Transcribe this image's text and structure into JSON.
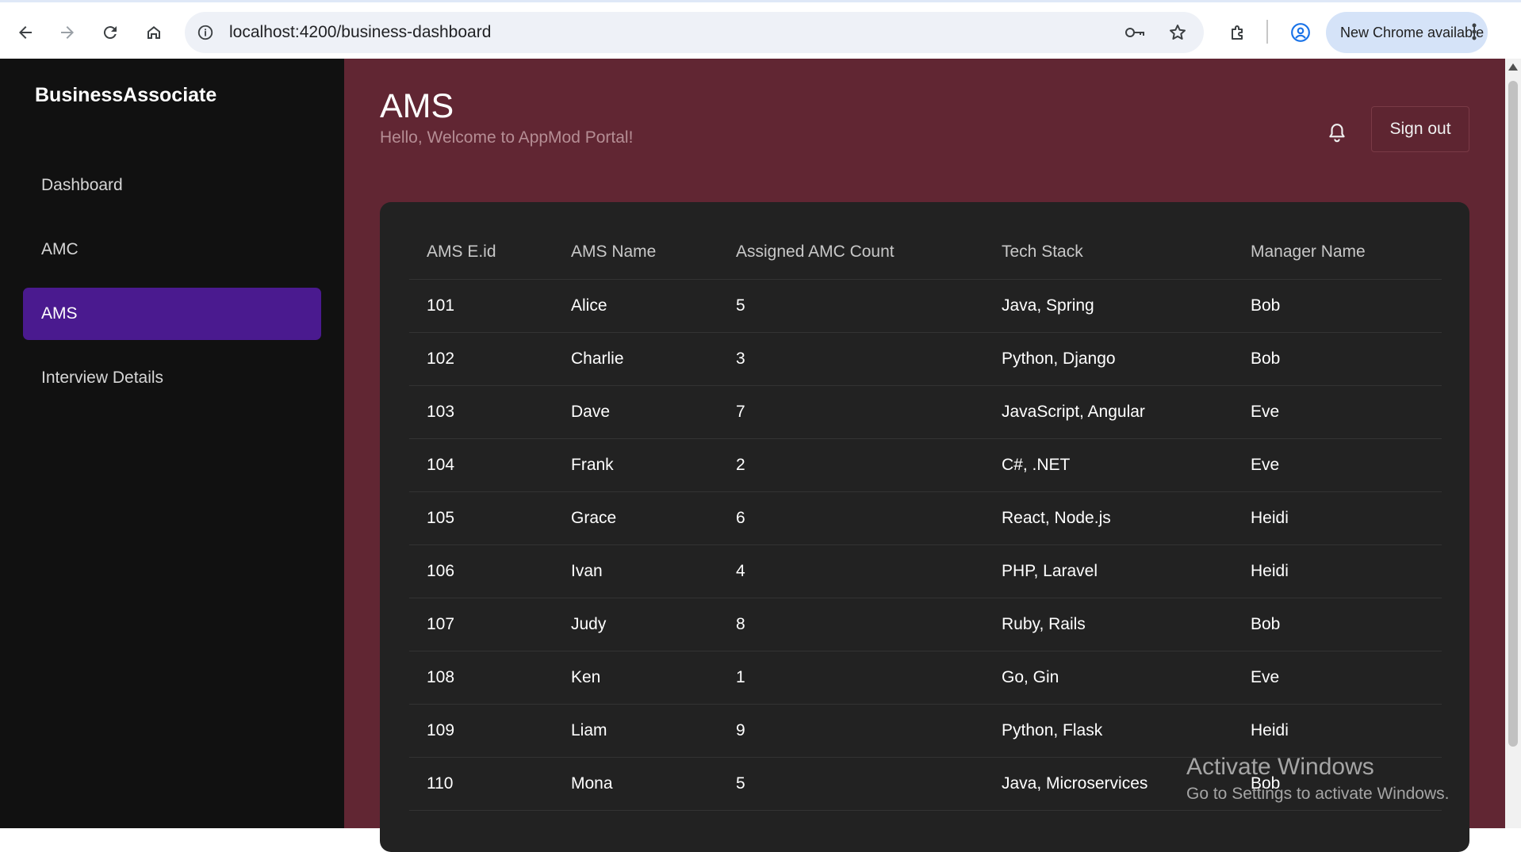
{
  "browser": {
    "url": "localhost:4200/business-dashboard",
    "update_label": "New Chrome available"
  },
  "sidebar": {
    "brand": "BusinessAssociate",
    "items": [
      {
        "label": "Dashboard"
      },
      {
        "label": "AMC"
      },
      {
        "label": "AMS",
        "active": true
      },
      {
        "label": "Interview Details"
      }
    ]
  },
  "header": {
    "title": "AMS",
    "subtitle": "Hello, Welcome to AppMod Portal!",
    "sign_out": "Sign out"
  },
  "table": {
    "headers": [
      "AMS E.id",
      "AMS Name",
      "Assigned AMC Count",
      "Tech Stack",
      "Manager Name"
    ],
    "rows": [
      [
        "101",
        "Alice",
        "5",
        "Java, Spring",
        "Bob"
      ],
      [
        "102",
        "Charlie",
        "3",
        "Python, Django",
        "Bob"
      ],
      [
        "103",
        "Dave",
        "7",
        "JavaScript, Angular",
        "Eve"
      ],
      [
        "104",
        "Frank",
        "2",
        "C#, .NET",
        "Eve"
      ],
      [
        "105",
        "Grace",
        "6",
        "React, Node.js",
        "Heidi"
      ],
      [
        "106",
        "Ivan",
        "4",
        "PHP, Laravel",
        "Heidi"
      ],
      [
        "107",
        "Judy",
        "8",
        "Ruby, Rails",
        "Bob"
      ],
      [
        "108",
        "Ken",
        "1",
        "Go, Gin",
        "Eve"
      ],
      [
        "109",
        "Liam",
        "9",
        "Python, Flask",
        "Heidi"
      ],
      [
        "110",
        "Mona",
        "5",
        "Java, Microservices",
        "Bob"
      ]
    ]
  },
  "watermark": {
    "line1": "Activate Windows",
    "line2": "Go to Settings to activate Windows."
  },
  "colors": {
    "sidebar_bg": "#111111",
    "active_nav": "#4a1a8f",
    "main_bg": "#612633",
    "card_bg": "#222222"
  }
}
